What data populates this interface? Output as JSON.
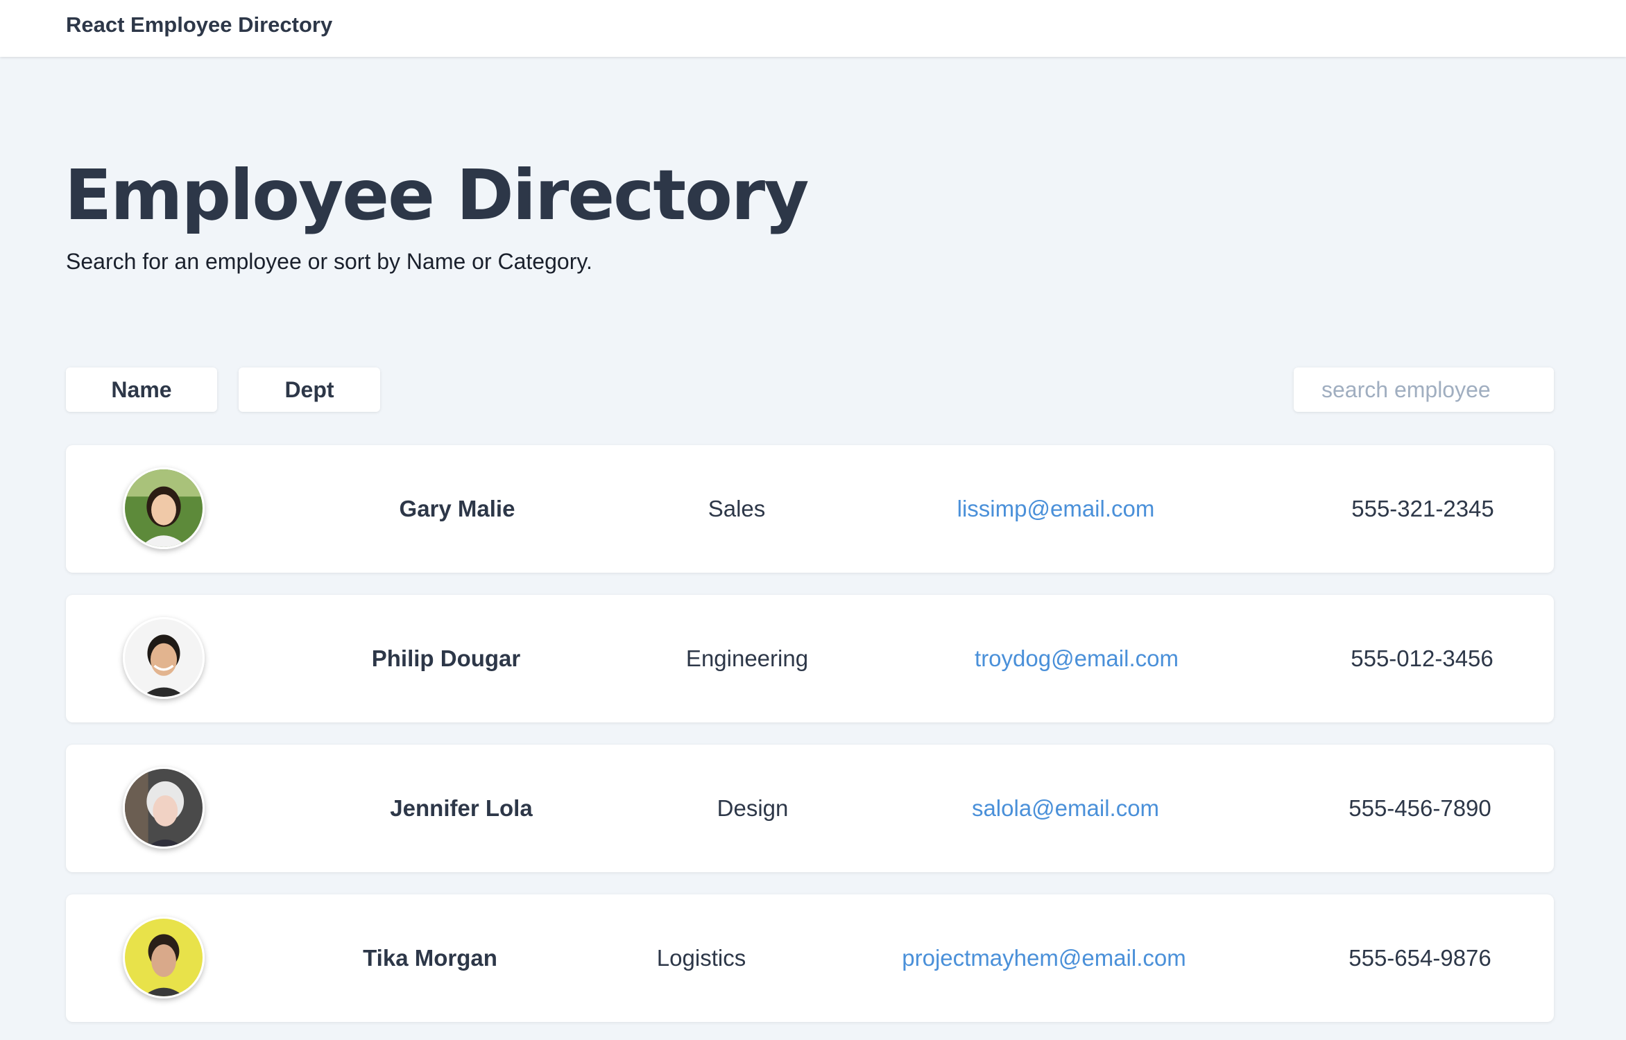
{
  "header": {
    "brand": "React Employee Directory"
  },
  "hero": {
    "title": "Employee Directory",
    "subtitle": "Search for an employee or sort by Name or Category."
  },
  "controls": {
    "sort_name_label": "Name",
    "sort_dept_label": "Dept",
    "search_placeholder": "search employee",
    "search_value": ""
  },
  "employees": [
    {
      "name": "Gary Malie",
      "dept": "Sales",
      "email": "lissimp@email.com",
      "phone": "555-321-2345"
    },
    {
      "name": "Philip Dougar",
      "dept": "Engineering",
      "email": "troydog@email.com",
      "phone": "555-012-3456"
    },
    {
      "name": "Jennifer Lola",
      "dept": "Design",
      "email": "salola@email.com",
      "phone": "555-456-7890"
    },
    {
      "name": "Tika Morgan",
      "dept": "Logistics",
      "email": "projectmayhem@email.com",
      "phone": "555-654-9876"
    }
  ],
  "colors": {
    "page_bg": "#f1f5f9",
    "text": "#2d3748",
    "link": "#4a90d9",
    "placeholder": "#a0aec0"
  }
}
